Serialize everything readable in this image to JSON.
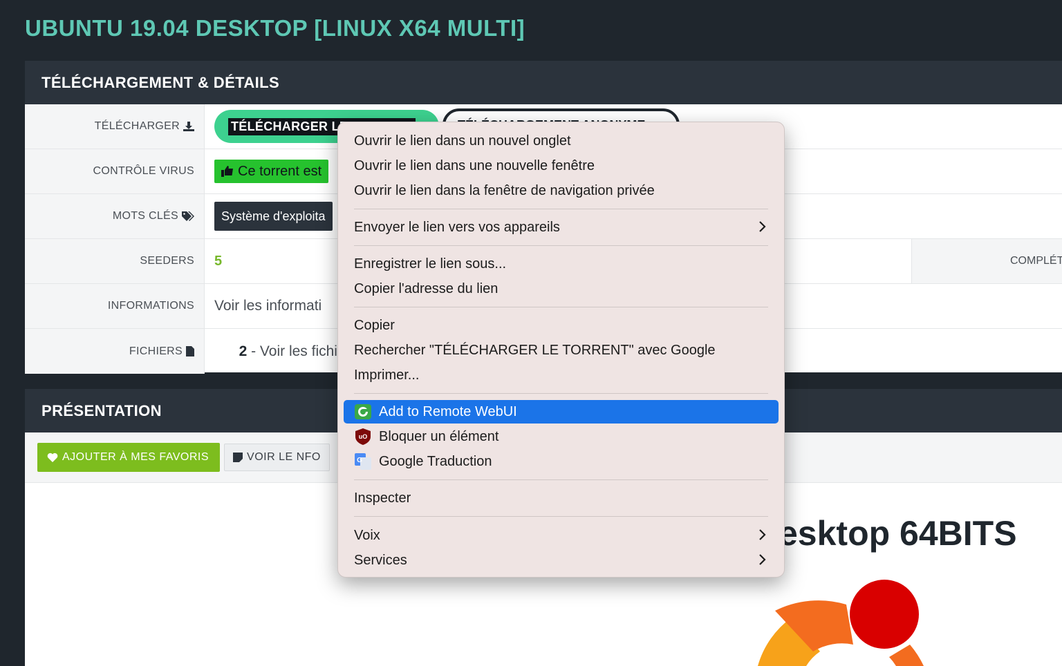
{
  "page": {
    "title": "UBUNTU 19.04 DESKTOP [LINUX X64 MULTI]"
  },
  "details": {
    "heading": "TÉLÉCHARGEMENT & DÉTAILS",
    "rows": {
      "download": {
        "label": "TÉLÉCHARGER",
        "button": "TÉLÉCHARGER LE TORRENT",
        "anon_button": "TÉLÉCHARGEMENT ANONYME"
      },
      "virus": {
        "label": "CONTRÔLE VIRUS",
        "badge": "Ce torrent est"
      },
      "tags": {
        "label": "MOTS CLÉS",
        "chip": "Système d'exploita"
      },
      "seeders": {
        "label": "SEEDERS",
        "value": "5",
        "complete_label": "COMPLÉT"
      },
      "info": {
        "label": "INFORMATIONS",
        "link": "Voir les informati"
      },
      "files": {
        "label": "FICHIERS",
        "count": "2",
        "sep": " - ",
        "link": "Voir les fichier"
      }
    }
  },
  "presentation": {
    "heading": "PRÉSENTATION",
    "fav_button": "AJOUTER À MES FAVORIS",
    "nfo_button": "VOIR LE NFO",
    "desc_heading": "esktop 64BITS"
  },
  "context_menu": {
    "open_new_tab": "Ouvrir le lien dans un nouvel onglet",
    "open_new_window": "Ouvrir le lien dans une nouvelle fenêtre",
    "open_private": "Ouvrir le lien dans la fenêtre de navigation privée",
    "send_to_devices": "Envoyer le lien vers vos appareils",
    "save_link_as": "Enregistrer le lien sous...",
    "copy_link_address": "Copier l'adresse du lien",
    "copy": "Copier",
    "search_google": "Rechercher \"TÉLÉCHARGER LE TORRENT\" avec Google",
    "print": "Imprimer...",
    "add_remote_webui": "Add to Remote WebUI",
    "block_element": "Bloquer un élément",
    "google_translate": "Google Traduction",
    "inspect": "Inspecter",
    "voice": "Voix",
    "services": "Services"
  },
  "colors": {
    "title": "#5ec8b4",
    "download_btn": "#3dd18f",
    "fav_btn": "#7dbd1e",
    "menu_highlight": "#1b74e8"
  }
}
